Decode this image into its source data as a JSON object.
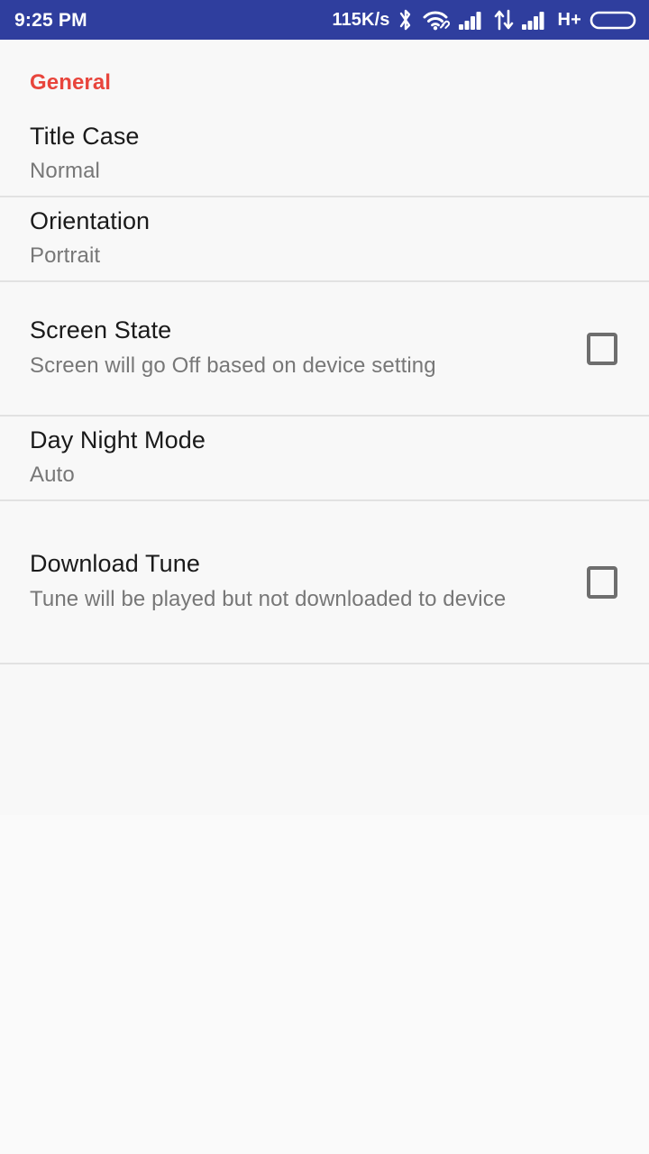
{
  "status_bar": {
    "clock": "9:25 PM",
    "network_speed": "115K/s",
    "network_type": "H+",
    "icons": [
      "bluetooth-icon",
      "wifi-icon",
      "signal-bars-sim1-icon",
      "data-transfer-icon",
      "signal-bars-sim2-icon",
      "battery-icon"
    ],
    "background_color": "#2F3E9E",
    "text_color": "#FFFFFF"
  },
  "screen": {
    "background_color": "#F8F8F8",
    "section_header": "General",
    "section_header_color": "#E8453C"
  },
  "preferences": [
    {
      "title": "Title Case",
      "summary": "Normal",
      "widget": "none",
      "checked": null
    },
    {
      "title": "Orientation",
      "summary": "Portrait",
      "widget": "none",
      "checked": null
    },
    {
      "title": "Screen State",
      "summary": "Screen will go Off based on device setting",
      "widget": "checkbox",
      "checked": false
    },
    {
      "title": "Day Night Mode",
      "summary": "Auto",
      "widget": "none",
      "checked": null
    },
    {
      "title": "Download Tune",
      "summary": "Tune will be played but not downloaded to device",
      "widget": "checkbox",
      "checked": false
    }
  ]
}
